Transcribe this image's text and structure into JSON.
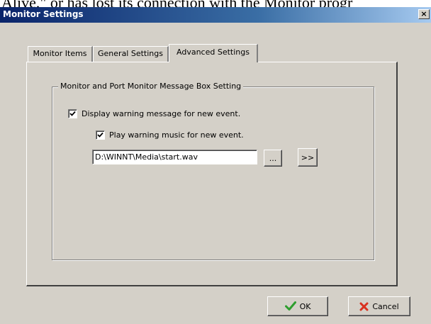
{
  "background_text": "Alive,\" or has lost its connection with the Monitor progr",
  "window": {
    "title": "Monitor Settings",
    "close_label": "×"
  },
  "tabs": [
    {
      "label": "Monitor Items",
      "active": false
    },
    {
      "label": "General Settings",
      "active": false
    },
    {
      "label": "Advanced Settings",
      "active": true
    }
  ],
  "group": {
    "title": "Monitor and Port Monitor Message Box Setting",
    "display_warning": {
      "label": "Display warning message for new event.",
      "checked": true
    },
    "play_music": {
      "label": "Play warning music for new event.",
      "checked": true
    },
    "sound_path": {
      "value": "D:\\WINNT\\Media\\start.wav"
    },
    "browse_label": "...",
    "play_label": ">>"
  },
  "buttons": {
    "ok_label": "OK",
    "cancel_label": "Cancel"
  },
  "colors": {
    "ok_icon": "#2e9e2e",
    "cancel_icon": "#d9311f",
    "titlebar_start": "#0a246a"
  }
}
